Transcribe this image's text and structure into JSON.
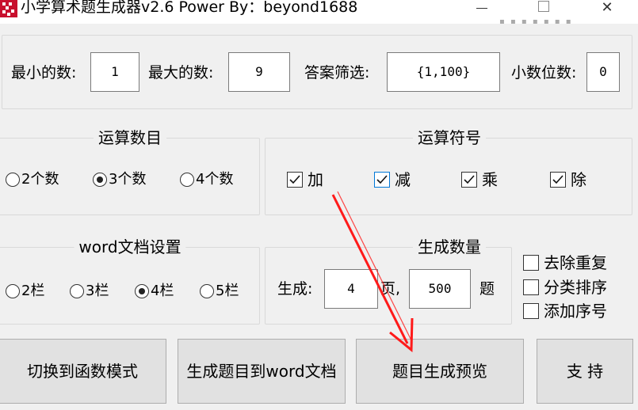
{
  "window": {
    "title": "小学算术题生成器v2.6  Power By：beyond1688",
    "minimize_glyph": "—",
    "close_glyph": "✕"
  },
  "range": {
    "min_label": "最小的数:",
    "min_value": "1",
    "max_label": "最大的数:",
    "max_value": "9",
    "filter_label": "答案筛选:",
    "filter_value": "{1,100}",
    "decimal_label": "小数位数:",
    "decimal_value": "0"
  },
  "operand_count": {
    "title": "运算数目",
    "options": [
      {
        "label": "2个数",
        "selected": false
      },
      {
        "label": "3个数",
        "selected": true
      },
      {
        "label": "4个数",
        "selected": false
      }
    ]
  },
  "operators": {
    "title": "运算符号",
    "items": [
      {
        "label": "加",
        "checked": true
      },
      {
        "label": "减",
        "checked": true
      },
      {
        "label": "乘",
        "checked": true
      },
      {
        "label": "除",
        "checked": true
      }
    ]
  },
  "word_settings": {
    "title": "word文档设置",
    "options": [
      {
        "label": "2栏",
        "selected": false
      },
      {
        "label": "3栏",
        "selected": false
      },
      {
        "label": "4栏",
        "selected": true
      },
      {
        "label": "5栏",
        "selected": false
      }
    ]
  },
  "quantity": {
    "title": "生成数量",
    "generate_label": "生成:",
    "pages_value": "4",
    "pages_suffix": "页,",
    "questions_value": "500",
    "questions_suffix": "题"
  },
  "options": {
    "dedupe": {
      "label": "去除重复",
      "checked": false
    },
    "sort": {
      "label": "分类排序",
      "checked": false
    },
    "numbering": {
      "label": "添加序号",
      "checked": false
    }
  },
  "buttons": {
    "function_mode": "切换到函数模式",
    "to_word": "生成题目到word文档",
    "preview": "题目生成预览",
    "support": "支 持"
  },
  "colors": {
    "arrow": "#ff1a1a",
    "app_icon": "#c8102e",
    "focus_check": "#0078d7"
  }
}
